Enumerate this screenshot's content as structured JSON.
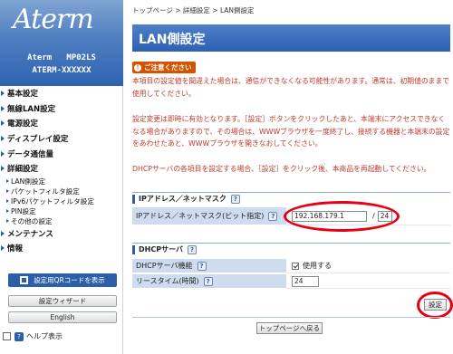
{
  "brand": {
    "logo": "Aterm",
    "model_line1": "Aterm   MP02LS",
    "model_line2": "ATERM-XXXXXX"
  },
  "sidebar": {
    "items": [
      {
        "label": "基本設定"
      },
      {
        "label": "無線LAN設定"
      },
      {
        "label": "電源設定"
      },
      {
        "label": "ディスプレイ設定"
      },
      {
        "label": "データ通信量"
      },
      {
        "label": "詳細設定"
      }
    ],
    "sub_items": [
      {
        "label": "LAN側設定"
      },
      {
        "label": "パケットフィルタ設定"
      },
      {
        "label": "IPv6パケットフィルタ設定"
      },
      {
        "label": "PIN設定"
      },
      {
        "label": "その他の設定"
      }
    ],
    "bottom_items": [
      {
        "label": "メンテナンス"
      },
      {
        "label": "情報"
      }
    ],
    "qr_button": "設定用QRコードを表示",
    "wizard_button": "設定ウィザード",
    "english_button": "English",
    "help_toggle": "ヘルプ表示",
    "help_mark": "?"
  },
  "breadcrumb": "トップページ > 詳細設定 > LAN側設定",
  "page_title": "LAN側設定",
  "notice": {
    "badge": "ご注意ください",
    "badge_icon": "!",
    "warning1": "本項目の設定値を間違えた場合は、通信ができなくなる可能性があります。通常は、初期値のままで使用してください。",
    "warning2": "設定変更は即時に有効となります。［設定］ボタンをクリックしたあと、本端末にアクセスできなくなる場合がありますので、その場合は、WWWブラウザを一度終了し、接続する機器と本端末の設定をあわせたあと、WWWブラウザを開きなおしてください。",
    "warning3": "DHCPサーバの各項目を設定する場合、［設定］をクリック後、本商品を再起動してください。"
  },
  "ip_section": {
    "title": "IPアドレス／ネットマスク",
    "help": "?",
    "row_label": "IPアドレス／ネットマスク(ビット指定)",
    "ip_value": "192.168.179.1",
    "slash": "/",
    "mask_value": "24"
  },
  "dhcp_section": {
    "title": "DHCPサーバ",
    "help": "?",
    "dhcp_label": "DHCPサーバ機能",
    "dhcp_value": "使用する",
    "dhcp_enabled": true,
    "lease_label": "リースタイム(時間)",
    "lease_value": "24"
  },
  "buttons": {
    "apply": "設定",
    "back_to_top": "トップページへ戻る"
  },
  "colors": {
    "accent": "#2f61b3",
    "warning_text": "#c0392b",
    "highlight_ring": "#e60012"
  }
}
